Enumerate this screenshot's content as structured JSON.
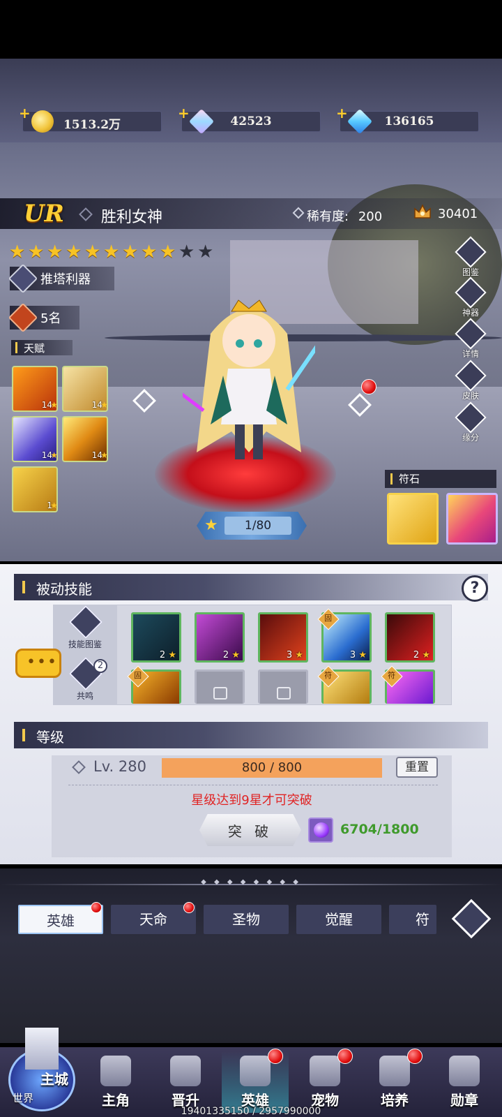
{
  "currencies": [
    {
      "name": "gold",
      "value": "1513.2万"
    },
    {
      "name": "crystal",
      "value": "42523"
    },
    {
      "name": "diamond",
      "value": "136165"
    }
  ],
  "hero": {
    "grade": "UR",
    "name": "胜利女神",
    "rarity_label": "稀有度:",
    "rarity_value": "200",
    "power": "30401",
    "stars_filled": 9,
    "stars_total": 11,
    "trait": "推塔利器",
    "rank": "5名",
    "level_progress": "1/80"
  },
  "talents": {
    "label": "天赋",
    "items": [
      {
        "level": "14"
      },
      {
        "level": "14"
      },
      {
        "level": "14"
      },
      {
        "level": "14"
      },
      {
        "level": "1"
      }
    ]
  },
  "side_buttons": [
    "图鉴",
    "神器",
    "详情",
    "皮肤",
    "缘分"
  ],
  "runes": {
    "label": "符石"
  },
  "passive": {
    "title": "被动技能",
    "help": "?",
    "side": [
      {
        "label": "技能图鉴"
      },
      {
        "label": "共鸣",
        "badge": "2"
      }
    ],
    "chat": "•••",
    "skills": [
      {
        "level": "2",
        "locked": false,
        "tag": ""
      },
      {
        "level": "2",
        "locked": false,
        "tag": ""
      },
      {
        "level": "3",
        "locked": false,
        "tag": ""
      },
      {
        "level": "3",
        "locked": false,
        "tag": "固"
      },
      {
        "level": "2",
        "locked": false,
        "tag": ""
      },
      {
        "level": "",
        "locked": false,
        "tag": "固"
      },
      {
        "level": "",
        "locked": true,
        "tag": ""
      },
      {
        "level": "",
        "locked": true,
        "tag": ""
      },
      {
        "level": "",
        "locked": false,
        "tag": "符"
      },
      {
        "level": "",
        "locked": false,
        "tag": "符"
      }
    ]
  },
  "level": {
    "title": "等级",
    "lv_text": "Lv. 280",
    "xp": "800 / 800",
    "xp_fraction": 1.0,
    "reset": "重置",
    "warning": "星级达到9星才可突破",
    "break_label": "突 破",
    "material_count": "6704/1800"
  },
  "tabs": [
    {
      "label": "英雄",
      "active": true,
      "dot": true
    },
    {
      "label": "天命",
      "active": false,
      "dot": true
    },
    {
      "label": "圣物",
      "active": false,
      "dot": false
    },
    {
      "label": "觉醒",
      "active": false,
      "dot": false
    },
    {
      "label": "符文",
      "active": false,
      "dot": false
    }
  ],
  "nav": {
    "castle_main": "主城",
    "castle_sub": "世界",
    "items": [
      {
        "label": "主角",
        "dot": false,
        "active": false
      },
      {
        "label": "晋升",
        "dot": false,
        "active": false
      },
      {
        "label": "英雄",
        "dot": true,
        "active": true
      },
      {
        "label": "宠物",
        "dot": true,
        "active": false
      },
      {
        "label": "培养",
        "dot": true,
        "active": false
      },
      {
        "label": "勋章",
        "dot": false,
        "active": false
      }
    ]
  },
  "footer": "19401335150 / 2957990000",
  "colors": {
    "accent_gold": "#f2c94c",
    "warning": "#e02424",
    "xp_bar": "#f4a25c",
    "badge_red": "#e20f0f"
  }
}
